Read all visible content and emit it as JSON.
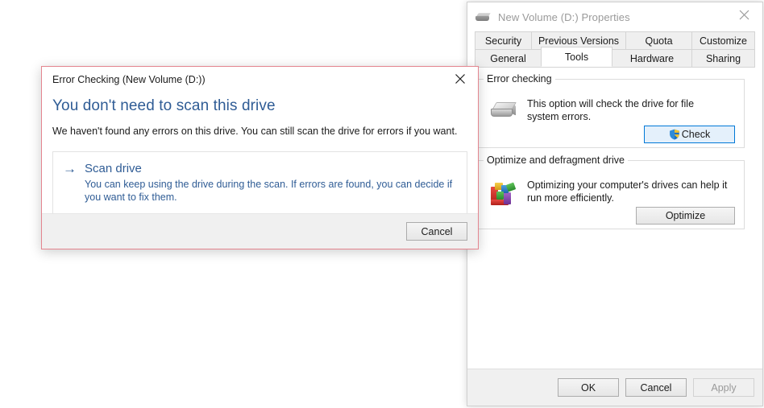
{
  "properties_window": {
    "title": "New Volume (D:) Properties",
    "title_icon": "hard-drive-icon",
    "close_icon": "close-icon",
    "tabs_row_top": [
      {
        "label": "Security",
        "active": false
      },
      {
        "label": "Previous Versions",
        "active": false
      },
      {
        "label": "Quota",
        "active": false
      },
      {
        "label": "Customize",
        "active": false
      }
    ],
    "tabs_row_bottom": [
      {
        "label": "General",
        "active": false
      },
      {
        "label": "Tools",
        "active": true
      },
      {
        "label": "Hardware",
        "active": false
      },
      {
        "label": "Sharing",
        "active": false
      }
    ],
    "error_checking_group": {
      "legend": "Error checking",
      "icon": "hard-drive-icon",
      "description": "This option will check the drive for file system errors.",
      "button_label": "Check",
      "button_icon": "uac-shield-icon",
      "button_focused": true
    },
    "optimize_group": {
      "legend": "Optimize and defragment drive",
      "icon": "defragment-blocks-icon",
      "description": "Optimizing your computer's drives can help it run more efficiently.",
      "button_label": "Optimize"
    },
    "footer": {
      "ok_label": "OK",
      "cancel_label": "Cancel",
      "apply_label": "Apply",
      "apply_disabled": true
    }
  },
  "error_checking_dialog": {
    "title": "Error Checking (New Volume (D:))",
    "close_icon": "close-icon",
    "heading": "You don't need to scan this drive",
    "subtext": "We haven't found any errors on this drive. You can still scan the drive for errors if you want.",
    "command_link": {
      "arrow_icon": "arrow-right-icon",
      "title": "Scan drive",
      "description": "You can keep using the drive during the scan. If errors are found, you can decide if you want to fix them."
    },
    "cancel_label": "Cancel"
  },
  "colors": {
    "accent_blue": "#2f5c95",
    "focus_blue": "#0078d7",
    "active_border_pink": "#e4858f"
  }
}
